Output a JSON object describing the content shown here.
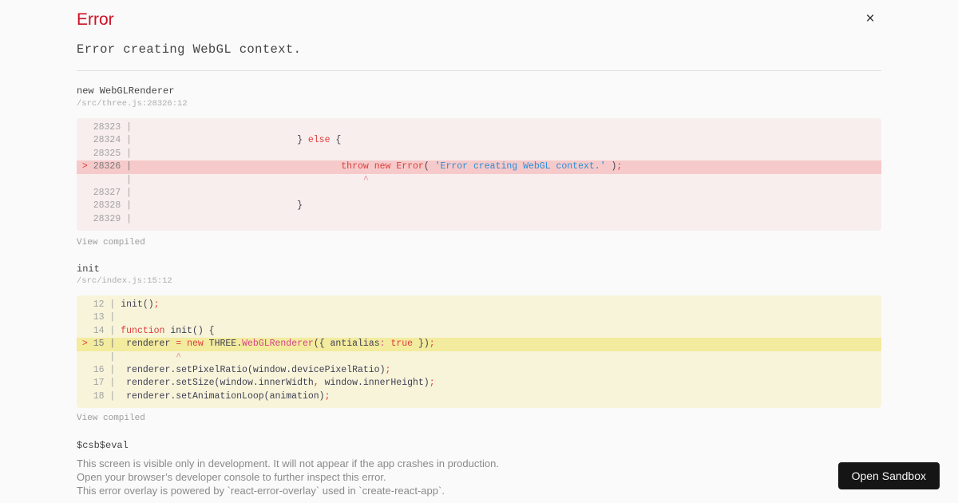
{
  "header": {
    "title": "Error",
    "close_icon": "×"
  },
  "error": {
    "message": "Error creating WebGL context."
  },
  "frames": [
    {
      "fn": "new WebGLRenderer",
      "path": "/src/three.js:28326:12",
      "view_link": "View compiled",
      "variant": "error",
      "lines": [
        {
          "m": " ",
          "n": "28323",
          "s": []
        },
        {
          "m": " ",
          "n": "28324",
          "s": [
            [
              "                             } ",
              "p"
            ],
            [
              "else",
              "r"
            ],
            [
              " {",
              "p"
            ]
          ]
        },
        {
          "m": " ",
          "n": "28325",
          "s": []
        },
        {
          "m": ">",
          "n": "28326",
          "h": true,
          "s": [
            [
              "                                     ",
              "p"
            ],
            [
              "throw",
              "r"
            ],
            [
              " ",
              "p"
            ],
            [
              "new",
              "r"
            ],
            [
              " ",
              "p"
            ],
            [
              "Error",
              "r"
            ],
            [
              "( ",
              "p"
            ],
            [
              "'Error creating WebGL context.'",
              "b"
            ],
            [
              " )",
              "p"
            ],
            [
              ";",
              "r"
            ]
          ]
        },
        {
          "m": " ",
          "n": "     ",
          "s": [
            [
              "                                         ",
              "p"
            ],
            [
              "^",
              "c"
            ]
          ]
        },
        {
          "m": " ",
          "n": "28327",
          "s": []
        },
        {
          "m": " ",
          "n": "28328",
          "s": [
            [
              "                             }",
              "p"
            ]
          ]
        },
        {
          "m": " ",
          "n": "28329",
          "s": []
        }
      ]
    },
    {
      "fn": "init",
      "path": "/src/index.js:15:12",
      "view_link": "View compiled",
      "variant": "warning",
      "lines": [
        {
          "m": " ",
          "n": "12",
          "s": [
            [
              "init()",
              "p"
            ],
            [
              ";",
              "r"
            ]
          ]
        },
        {
          "m": " ",
          "n": "13",
          "s": []
        },
        {
          "m": " ",
          "n": "14",
          "s": [
            [
              "function",
              "r"
            ],
            [
              " init() {",
              "p"
            ]
          ]
        },
        {
          "m": ">",
          "n": "15",
          "h": true,
          "s": [
            [
              " renderer ",
              "p"
            ],
            [
              "=",
              "r"
            ],
            [
              " ",
              "p"
            ],
            [
              "new",
              "r"
            ],
            [
              " THREE.",
              "p"
            ],
            [
              "WebGLRenderer",
              "mg"
            ],
            [
              "({ antialias",
              "p"
            ],
            [
              ":",
              "mg"
            ],
            [
              " ",
              "p"
            ],
            [
              "true",
              "r"
            ],
            [
              " })",
              "p"
            ],
            [
              ";",
              "r"
            ]
          ]
        },
        {
          "m": " ",
          "n": "  ",
          "s": [
            [
              "          ",
              "p"
            ],
            [
              "^",
              "c"
            ]
          ]
        },
        {
          "m": " ",
          "n": "16",
          "s": [
            [
              " renderer.setPixelRatio(window.devicePixelRatio)",
              "p"
            ],
            [
              ";",
              "r"
            ]
          ]
        },
        {
          "m": " ",
          "n": "17",
          "s": [
            [
              " renderer.setSize(window.innerWidth",
              "p"
            ],
            [
              ",",
              "r"
            ],
            [
              " window.innerHeight)",
              "p"
            ],
            [
              ";",
              "r"
            ]
          ]
        },
        {
          "m": " ",
          "n": "18",
          "s": [
            [
              " renderer.setAnimationLoop(animation)",
              "p"
            ],
            [
              ";",
              "r"
            ]
          ]
        }
      ]
    }
  ],
  "eval_frame": {
    "fn": "$csb$eval"
  },
  "footer": {
    "lines": [
      "This screen is visible only in development. It will not appear if the app crashes in production.",
      "Open your browser’s developer console to further inspect this error.",
      "This error overlay is powered by `react-error-overlay` used in `create-react-app`."
    ]
  },
  "sandbox_button": {
    "label": "Open Sandbox"
  },
  "colors": {
    "title_red": "#ce1126",
    "keyword": "#de3d3b",
    "string": "#288ed7",
    "classname": "#d6438a",
    "error_block_bg": "#f8eeee",
    "error_line_hl": "#f6caca",
    "warning_block_bg": "#f7f4da",
    "warning_line_hl": "#f3eb9e",
    "page_bg": "#fafafa",
    "button_bg": "#151515"
  }
}
